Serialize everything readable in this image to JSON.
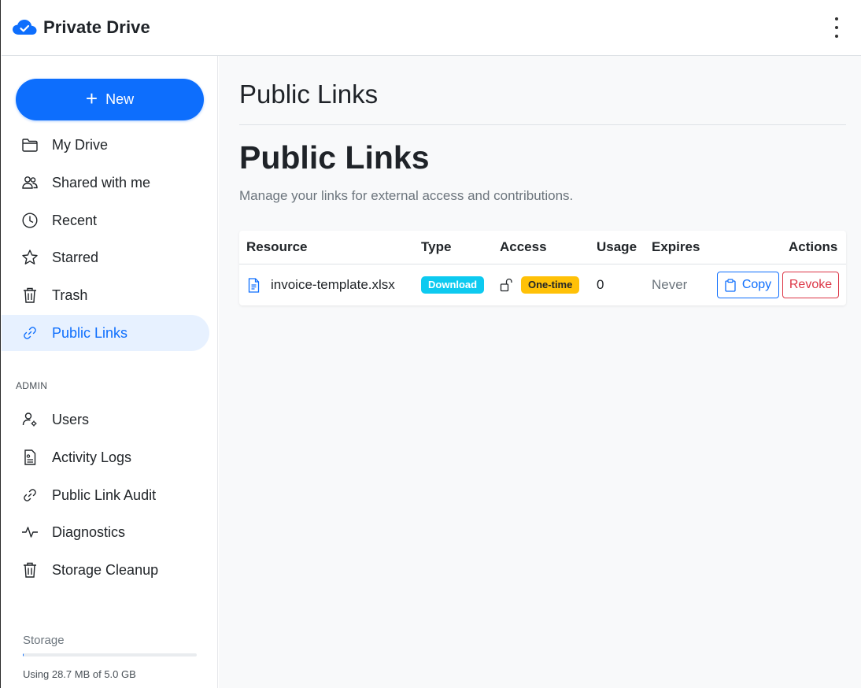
{
  "app": {
    "title": "Private Drive"
  },
  "sidebar": {
    "new_label": "New",
    "nav": [
      {
        "label": "My Drive",
        "icon": "folder-icon"
      },
      {
        "label": "Shared with me",
        "icon": "people-icon"
      },
      {
        "label": "Recent",
        "icon": "clock-icon"
      },
      {
        "label": "Starred",
        "icon": "star-icon"
      },
      {
        "label": "Trash",
        "icon": "trash-icon"
      },
      {
        "label": "Public Links",
        "icon": "link-icon",
        "active": true
      }
    ],
    "admin_label": "ADMIN",
    "admin": [
      {
        "label": "Users",
        "icon": "user-gear-icon"
      },
      {
        "label": "Activity Logs",
        "icon": "file-list-icon"
      },
      {
        "label": "Public Link Audit",
        "icon": "link-icon"
      },
      {
        "label": "Diagnostics",
        "icon": "activity-icon"
      },
      {
        "label": "Storage Cleanup",
        "icon": "trash-icon"
      }
    ],
    "storage": {
      "title": "Storage",
      "used_fraction": 0.0056,
      "text": "Using 28.7 MB of 5.0 GB"
    }
  },
  "main": {
    "header_title": "Public Links",
    "title": "Public Links",
    "subtitle": "Manage your links for external access and contributions.",
    "table": {
      "columns": [
        "Resource",
        "Type",
        "Access",
        "Usage",
        "Expires",
        "Actions"
      ],
      "rows": [
        {
          "resource": "invoice-template.xlsx",
          "type": "Download",
          "access": "One-time",
          "usage": "0",
          "expires": "Never",
          "copy_label": "Copy",
          "revoke_label": "Revoke"
        }
      ]
    }
  },
  "colors": {
    "primary": "#0d6efd",
    "info": "#0dcaf0",
    "warning": "#ffc107",
    "danger": "#dc3545",
    "active_bg": "#e7f1ff"
  }
}
